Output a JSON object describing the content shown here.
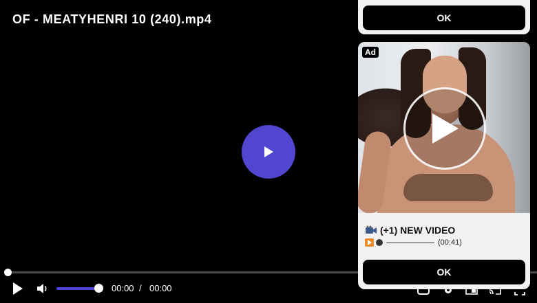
{
  "video": {
    "title": "OF - MEATYHENRI 10 (240).mp4"
  },
  "controls": {
    "current_time": "00:00",
    "separator": "/",
    "duration": "00:00",
    "progress": 0.0,
    "volume": 1.0
  },
  "colors": {
    "accent": "#5146cf",
    "background": "#000000",
    "ad_panel": "#f2f2f2"
  },
  "ads": {
    "top": {
      "ok_label": "OK"
    },
    "card": {
      "badge": "Ad",
      "headline": "(+1) NEW VIDEO",
      "subline_time": "(00:41)",
      "ok_label": "OK"
    }
  },
  "icons": {
    "big_play": "play-icon",
    "play": "play-icon",
    "volume": "volume-icon",
    "captions": "captions-icon",
    "settings": "gear-icon",
    "pip": "picture-in-picture-icon",
    "cast": "cast-icon",
    "fullscreen": "fullscreen-icon",
    "ad_video": "video-camera-icon",
    "ad_play": "play-button-icon"
  }
}
